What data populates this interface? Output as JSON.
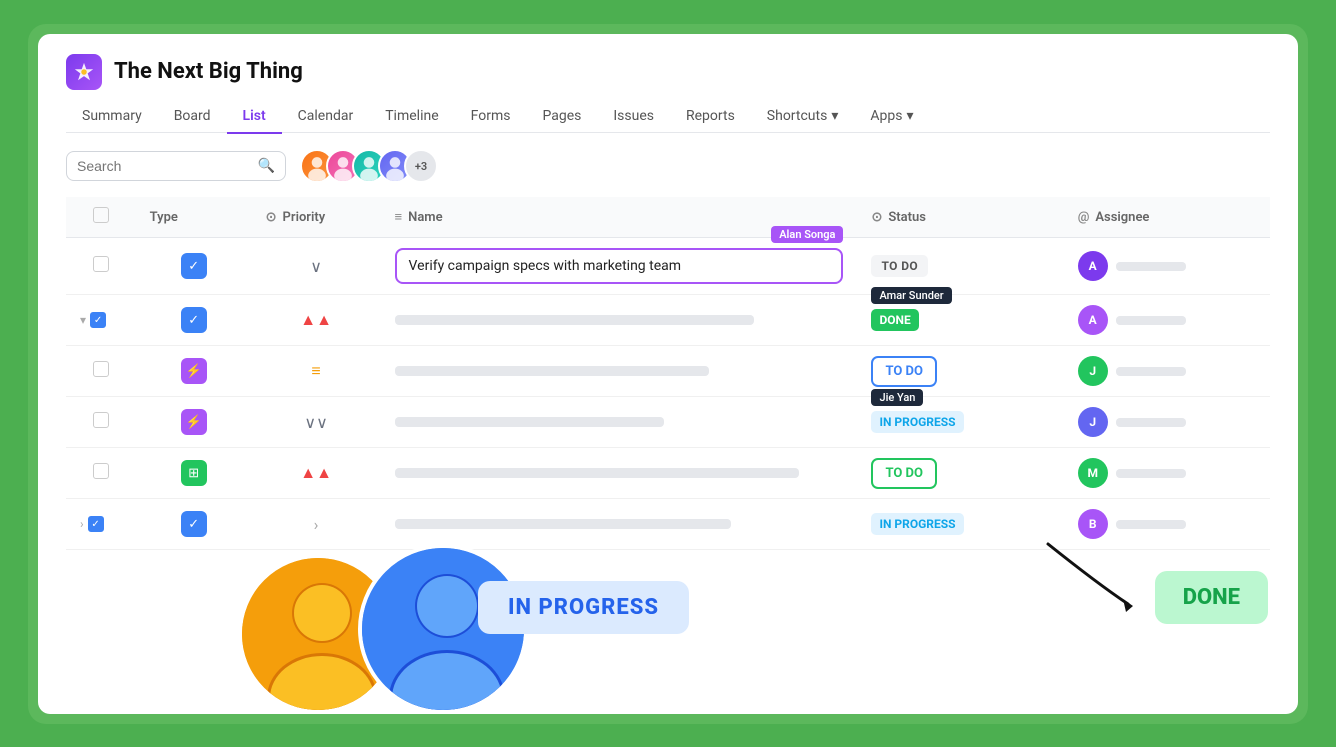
{
  "app": {
    "title": "The Next Big Thing"
  },
  "nav": {
    "tabs": [
      {
        "label": "Summary",
        "active": false
      },
      {
        "label": "Board",
        "active": false
      },
      {
        "label": "List",
        "active": true
      },
      {
        "label": "Calendar",
        "active": false
      },
      {
        "label": "Timeline",
        "active": false
      },
      {
        "label": "Forms",
        "active": false
      },
      {
        "label": "Pages",
        "active": false
      },
      {
        "label": "Issues",
        "active": false
      },
      {
        "label": "Reports",
        "active": false
      },
      {
        "label": "Shortcuts",
        "active": false,
        "hasArrow": true
      },
      {
        "label": "Apps",
        "active": false,
        "hasArrow": true
      }
    ]
  },
  "toolbar": {
    "search_placeholder": "Search",
    "avatars_extra": "+3"
  },
  "table": {
    "columns": [
      {
        "label": "",
        "icon": ""
      },
      {
        "label": "Type",
        "icon": ""
      },
      {
        "label": "Priority",
        "icon": "⊙"
      },
      {
        "label": "Name",
        "icon": "≡"
      },
      {
        "label": "Status",
        "icon": "⊙"
      },
      {
        "label": "Assignee",
        "icon": "@"
      }
    ],
    "rows": [
      {
        "id": 1,
        "checked": true,
        "typeIcon": "check",
        "priority": "low",
        "prioritySymbol": "∨",
        "nameHighlighted": true,
        "nameText": "Verify campaign specs with marketing team",
        "tooltipUser": "Alan Songa",
        "status": "todo",
        "statusLabel": "TO DO",
        "assigneeColor": "#7c3aed",
        "assigneeInitial": "A"
      },
      {
        "id": 2,
        "checked": true,
        "hasExpand": true,
        "typeIcon": "check",
        "priority": "high",
        "prioritySymbol": "⋀",
        "nameHighlighted": false,
        "nameBar": "w80",
        "status": "done",
        "statusLabel": "DONE",
        "tooltipStatus": "Amar Sunder",
        "assigneeColor": "#a855f7",
        "assigneeInitial": "A"
      },
      {
        "id": 3,
        "checked": false,
        "typeIcon": "bolt",
        "priority": "medium",
        "prioritySymbol": "=",
        "nameHighlighted": false,
        "nameBar": "w70",
        "status": "todo-outlined",
        "statusLabel": "TO DO",
        "assigneeColor": "#22c55e",
        "assigneeInitial": "J"
      },
      {
        "id": 4,
        "checked": false,
        "typeIcon": "bolt",
        "priority": "low2",
        "prioritySymbol": "⋁",
        "nameHighlighted": false,
        "nameBar": "w60",
        "status": "inprogress",
        "statusLabel": "IN PROGRESS",
        "tooltipUser": "Jie Yan",
        "assigneeColor": "#6366f1",
        "assigneeInitial": "J"
      },
      {
        "id": 5,
        "checked": false,
        "typeIcon": "grid",
        "priority": "high",
        "prioritySymbol": "⋀",
        "nameHighlighted": false,
        "nameBar": "w90",
        "status": "todo-green-outlined",
        "statusLabel": "TO DO",
        "assigneeColor": "#22c55e",
        "assigneeInitial": "M"
      },
      {
        "id": 6,
        "checked": true,
        "hasExpand": true,
        "typeIcon": "check",
        "priority": "medium",
        "prioritySymbol": ">",
        "nameHighlighted": false,
        "nameBar": "w75",
        "status": "inprogress",
        "statusLabel": "IN PROGRESS",
        "assigneeColor": "#a855f7",
        "assigneeInitial": "B"
      }
    ]
  },
  "overlays": {
    "inProgressLabel": "IN PROGRESS",
    "doneLabel": "DONE"
  }
}
